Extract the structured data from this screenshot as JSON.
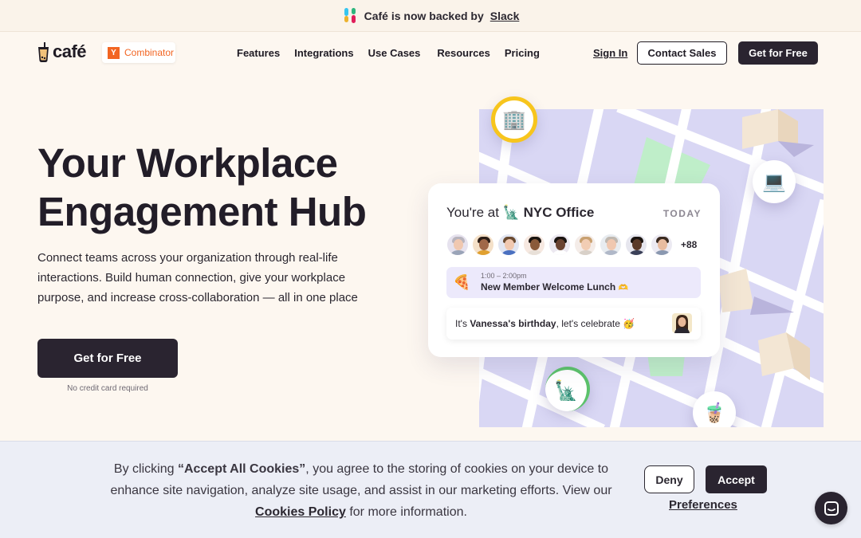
{
  "announcement": {
    "text": "Café is now backed by",
    "link": "Slack",
    "icon": "slack-icon"
  },
  "header": {
    "logo_text": "café",
    "logo_icon": "boba-cup-icon",
    "yc_letter": "Y",
    "yc_text": "Combinator",
    "nav": [
      "Features",
      "Integrations",
      "Use Cases",
      "Resources",
      "Pricing"
    ],
    "sign_in": "Sign In",
    "contact_sales": "Contact Sales",
    "get_for_free": "Get for Free"
  },
  "hero": {
    "title_line1": "Your Workplace",
    "title_line2": "Engagement Hub",
    "description": "Connect teams across your organization through real-life interactions. Build human connection, give your workplace purpose, and increase cross-collaboration — all in one place",
    "cta": "Get for Free",
    "cta_note": "No credit card required"
  },
  "card": {
    "title_prefix": "You're at",
    "title_icon": "🗽",
    "location": "NYC Office",
    "today": "TODAY",
    "avatars_more": "+88",
    "event_icon": "🍕",
    "event_time": "1:00 – 2:00pm",
    "event_name": "New Member Welcome Lunch",
    "event_emoji": "🫶",
    "bday_prefix": "It's",
    "bday_name": "Vanessa's birthday",
    "bday_suffix": ", let's celebrate",
    "bday_emoji": "🥳"
  },
  "map_pins": {
    "office": "🏢",
    "laptop": "💻",
    "liberty": "🗽",
    "boba": "🧋"
  },
  "cookie": {
    "prefix": "By clicking ",
    "bold": "“Accept All Cookies”",
    "middle": ", you agree to the storing of cookies on your device to enhance site navigation, analyze site usage, and assist in our marketing efforts. View our ",
    "policy": "Cookies Policy",
    "suffix": " for more information.",
    "deny": "Deny",
    "accept": "Accept",
    "preferences": "Preferences"
  },
  "colors": {
    "dark": "#2a2430",
    "background": "#fdf7f0",
    "map": "#d9d7f4",
    "yc_orange": "#f26522",
    "cookie_bg": "#eceef6"
  }
}
